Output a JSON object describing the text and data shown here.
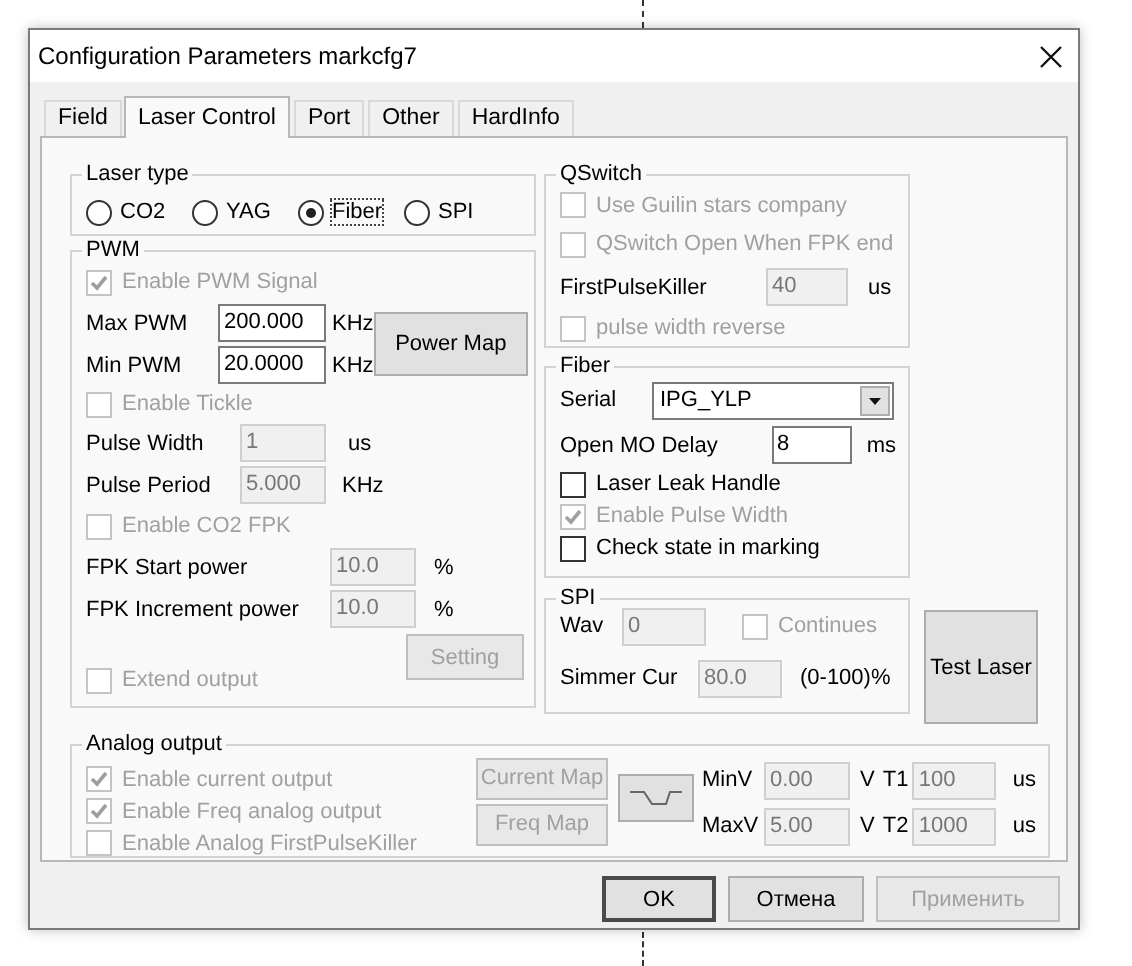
{
  "window": {
    "title": "Configuration Parameters markcfg7"
  },
  "tabs": [
    {
      "label": "Field",
      "selected": false
    },
    {
      "label": "Laser Control",
      "selected": true
    },
    {
      "label": "Port",
      "selected": false
    },
    {
      "label": "Other",
      "selected": false
    },
    {
      "label": "HardInfo",
      "selected": false
    }
  ],
  "laser_type": {
    "title": "Laser type",
    "options": [
      {
        "label": "CO2",
        "selected": false
      },
      {
        "label": "YAG",
        "selected": false
      },
      {
        "label": "Fiber",
        "selected": true
      },
      {
        "label": "SPI",
        "selected": false
      }
    ]
  },
  "pwm": {
    "title": "PWM",
    "enable_pwm_signal": {
      "label": "Enable PWM Signal",
      "checked": true,
      "disabled": true
    },
    "max_pwm": {
      "label": "Max PWM",
      "value": "200.000",
      "unit": "KHz",
      "disabled": false
    },
    "min_pwm": {
      "label": "Min PWM",
      "value": "20.0000",
      "unit": "KHz",
      "disabled": false
    },
    "power_map_button": {
      "label": "Power Map",
      "disabled": false
    },
    "enable_tickle": {
      "label": "Enable Tickle",
      "checked": false,
      "disabled": true
    },
    "pulse_width": {
      "label": "Pulse Width",
      "value": "1",
      "unit": "us",
      "disabled": true
    },
    "pulse_period": {
      "label": "Pulse Period",
      "value": "5.000",
      "unit": "KHz",
      "disabled": true
    },
    "enable_co2_fpk": {
      "label": "Enable CO2 FPK",
      "checked": false,
      "disabled": true
    },
    "fpk_start_power": {
      "label": "FPK Start power",
      "value": "10.0",
      "unit": "%",
      "disabled": true
    },
    "fpk_increment_power": {
      "label": "FPK Increment power",
      "value": "10.0",
      "unit": "%",
      "disabled": true
    },
    "setting_button": {
      "label": "Setting",
      "disabled": true
    },
    "extend_output": {
      "label": "Extend output",
      "checked": false,
      "disabled": true
    }
  },
  "qswitch": {
    "title": "QSwitch",
    "use_guilin_stars": {
      "label": "Use Guilin stars company",
      "checked": false,
      "disabled": true
    },
    "open_when_fpk_end": {
      "label": "QSwitch Open When FPK end",
      "checked": false,
      "disabled": true
    },
    "first_pulse_killer": {
      "label": "FirstPulseKiller",
      "value": "40",
      "unit": "us",
      "disabled": true
    },
    "pulse_width_reverse": {
      "label": "pulse width reverse",
      "checked": false,
      "disabled": true
    }
  },
  "fiber": {
    "title": "Fiber",
    "serial": {
      "label": "Serial",
      "value": "IPG_YLP"
    },
    "open_mo_delay": {
      "label": "Open MO Delay",
      "value": "8",
      "unit": "ms",
      "disabled": false
    },
    "laser_leak_handle": {
      "label": "Laser Leak Handle",
      "checked": false,
      "disabled": false
    },
    "enable_pulse_width": {
      "label": "Enable Pulse Width",
      "checked": true,
      "disabled": true
    },
    "check_state_in_marking": {
      "label": "Check state in marking",
      "checked": false,
      "disabled": false
    }
  },
  "spi": {
    "title": "SPI",
    "wave": {
      "label": "Wav",
      "value": "0",
      "disabled": true
    },
    "continues": {
      "label": "Continues",
      "checked": false,
      "disabled": true
    },
    "simmer_cur": {
      "label": "Simmer Cur",
      "value": "80.0",
      "unit": "(0-100)%",
      "disabled": true
    }
  },
  "test_laser_button": {
    "label": "Test Laser",
    "disabled": false
  },
  "analog_output": {
    "title": "Analog output",
    "enable_current_output": {
      "label": "Enable current output",
      "checked": true,
      "disabled": true
    },
    "enable_freq_analog_output": {
      "label": "Enable Freq analog output",
      "checked": true,
      "disabled": true
    },
    "enable_analog_first_pulse_killer": {
      "label": "Enable Analog FirstPulseKiller",
      "checked": false,
      "disabled": true
    },
    "current_map_button": {
      "label": "Current Map",
      "disabled": true
    },
    "freq_map_button": {
      "label": "Freq Map",
      "disabled": true
    },
    "min_v": {
      "label": "MinV",
      "value": "0.00",
      "unit": "V",
      "disabled": true
    },
    "t1": {
      "label": "T1",
      "value": "100",
      "unit": "us",
      "disabled": true
    },
    "max_v": {
      "label": "MaxV",
      "value": "5.00",
      "unit": "V",
      "disabled": true
    },
    "t2": {
      "label": "T2",
      "value": "1000",
      "unit": "us",
      "disabled": true
    }
  },
  "buttons": [
    {
      "label": "OK",
      "default": true,
      "disabled": false
    },
    {
      "label": "Отмена",
      "default": false,
      "disabled": false
    },
    {
      "label": "Применить",
      "default": false,
      "disabled": true
    }
  ]
}
